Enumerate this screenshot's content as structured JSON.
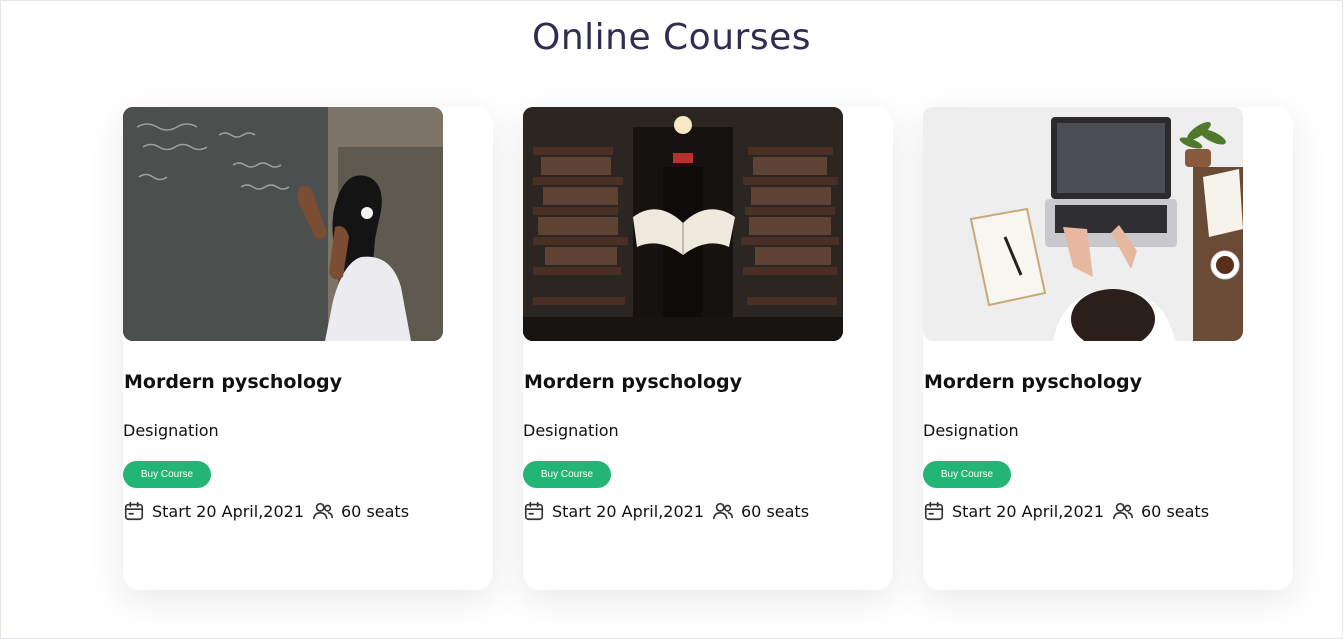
{
  "page": {
    "title": "Online Courses"
  },
  "courses": [
    {
      "title": "Mordern pyschology",
      "designation": "Designation",
      "button_label": "Buy Course",
      "start": "Start 20 April,2021",
      "seats": "60 seats",
      "image": "student-at-chalkboard"
    },
    {
      "title": "Mordern pyschology",
      "designation": "Designation",
      "button_label": "Buy Course",
      "start": "Start 20 April,2021",
      "seats": "60 seats",
      "image": "library-floating-book"
    },
    {
      "title": "Mordern pyschology",
      "designation": "Designation",
      "button_label": "Buy Course",
      "start": "Start 20 April,2021",
      "seats": "60 seats",
      "image": "laptop-desk-study"
    }
  ],
  "icons": {
    "calendar": "calendar-icon",
    "seats": "users-icon"
  },
  "colors": {
    "title": "#2f2d52",
    "button": "#22b573",
    "text": "#111111"
  }
}
